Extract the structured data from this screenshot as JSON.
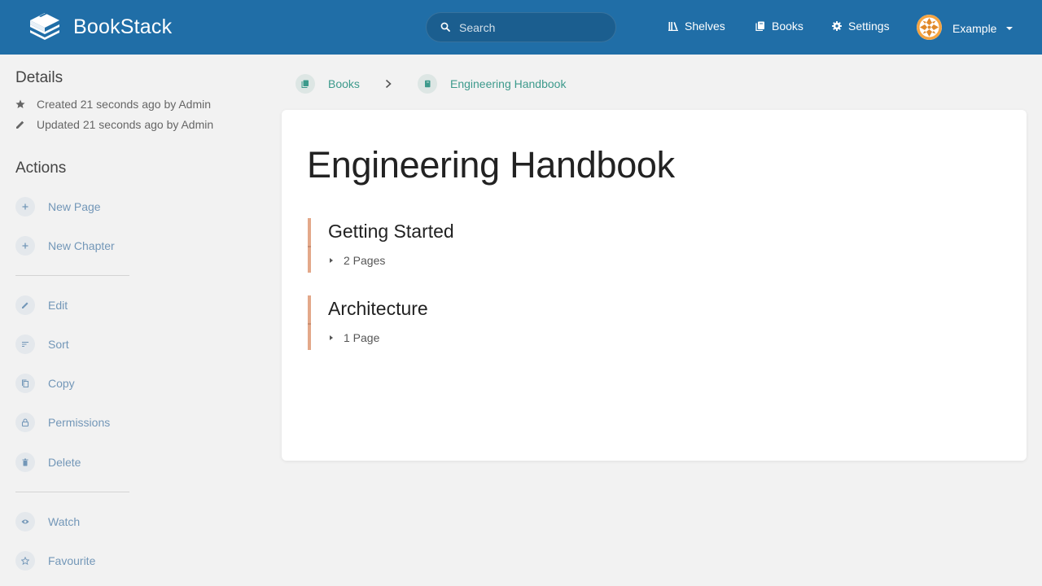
{
  "app": {
    "name": "BookStack"
  },
  "header": {
    "search": {
      "placeholder": "Search"
    },
    "nav": {
      "shelves": "Shelves",
      "books": "Books",
      "settings": "Settings"
    },
    "user": {
      "name": "Example"
    }
  },
  "sidebar": {
    "details": {
      "title": "Details",
      "created": "Created 21 seconds ago by Admin",
      "updated": "Updated 21 seconds ago by Admin"
    },
    "actions": {
      "title": "Actions",
      "new_page": "New Page",
      "new_chapter": "New Chapter",
      "edit": "Edit",
      "sort": "Sort",
      "copy": "Copy",
      "permissions": "Permissions",
      "delete": "Delete",
      "watch": "Watch",
      "favourite": "Favourite"
    }
  },
  "breadcrumb": {
    "items": [
      {
        "label": "Books"
      },
      {
        "label": "Engineering Handbook"
      }
    ]
  },
  "book": {
    "title": "Engineering Handbook",
    "chapters": [
      {
        "name": "Getting Started",
        "pages_label": "2 Pages"
      },
      {
        "name": "Architecture",
        "pages_label": "1 Page"
      }
    ]
  },
  "colors": {
    "header": "#206ea7",
    "link": "#7397b8",
    "book_accent": "#3d9a8c",
    "chapter_accent": "#e3a88a"
  }
}
